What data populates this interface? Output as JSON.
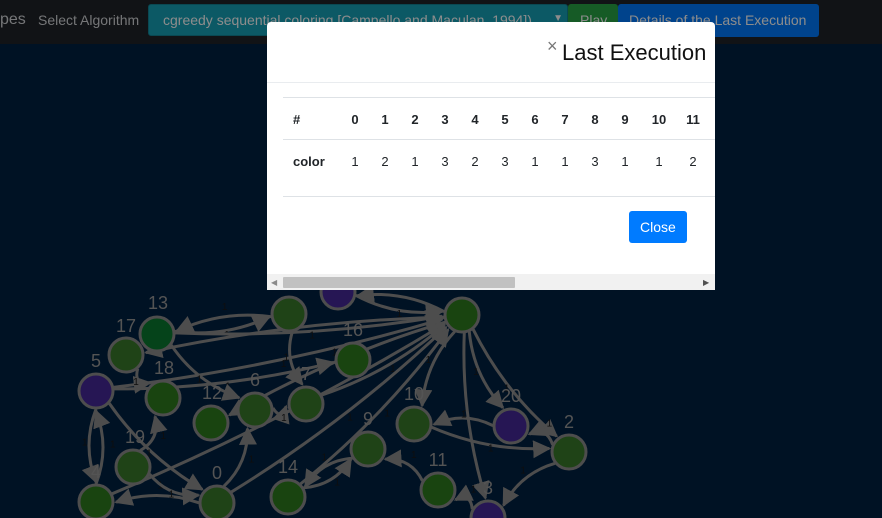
{
  "navbar": {
    "cut_text": "pes",
    "select_label": "Select Algorithm",
    "algorithm_value": "cgreedy sequential coloring [Campello and Maculan, 1994])",
    "play_label": "Play",
    "details_label": "Details of the Last Execution"
  },
  "graph": {
    "nodes": [
      {
        "id": "13",
        "label": "13",
        "color": "#0a7a30"
      },
      {
        "id": "17",
        "label": "17",
        "color": "#3a7a2a"
      },
      {
        "id": "5",
        "label": "5",
        "color": "#45289a"
      },
      {
        "id": "18",
        "label": "18",
        "color": "#2e7d1e"
      },
      {
        "id": "12",
        "label": "12",
        "color": "#2e7d1e"
      },
      {
        "id": "6",
        "label": "6",
        "color": "#3a7a2a"
      },
      {
        "id": "7",
        "label": "7",
        "color": "#3a7a2a"
      },
      {
        "id": "16",
        "label": "16",
        "color": "#2e7d1e"
      },
      {
        "id": "19",
        "label": "19",
        "color": "#3a7a2a"
      },
      {
        "id": "4",
        "label": "4",
        "color": "#2e7d1e"
      },
      {
        "id": "0",
        "label": "0",
        "color": "#3a7a2a"
      },
      {
        "id": "14",
        "label": "14",
        "color": "#2e7d1e"
      },
      {
        "id": "9",
        "label": "9",
        "color": "#3a7a2a"
      },
      {
        "id": "11",
        "label": "11",
        "color": "#2e7d1e"
      },
      {
        "id": "10",
        "label": "10",
        "color": "#3a7a2a"
      },
      {
        "id": "20",
        "label": "20",
        "color": "#45289a"
      },
      {
        "id": "2",
        "label": "2",
        "color": "#3a7a2a"
      },
      {
        "id": "3",
        "label": "3",
        "color": "#45289a"
      },
      {
        "id": "top",
        "label": "",
        "color": "#3a7a2a"
      },
      {
        "id": "topv",
        "label": "",
        "color": "#45289a"
      },
      {
        "id": "1",
        "label": "",
        "color": "#2e7d1e"
      }
    ],
    "edge_label": "1"
  },
  "modal": {
    "title": "Last Execution",
    "close_x": "×",
    "close_label": "Close",
    "row_headers": [
      "#",
      "color"
    ],
    "indices": [
      "0",
      "1",
      "2",
      "3",
      "4",
      "5",
      "6",
      "7",
      "8",
      "9",
      "10",
      "11"
    ],
    "colors": [
      "1",
      "2",
      "1",
      "3",
      "2",
      "3",
      "1",
      "1",
      "3",
      "1",
      "1",
      "2"
    ]
  }
}
